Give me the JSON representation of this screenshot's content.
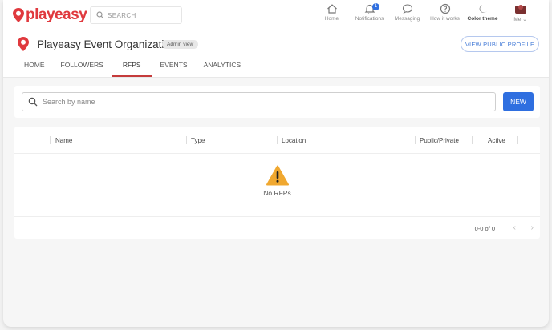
{
  "brand": {
    "logo_text": "playeasy"
  },
  "search": {
    "placeholder": "SEARCH"
  },
  "nav": {
    "items": [
      {
        "label": "Home",
        "icon": "home-icon"
      },
      {
        "label": "Notifications",
        "icon": "bell-icon",
        "badge": "1"
      },
      {
        "label": "Messaging",
        "icon": "chat-icon"
      },
      {
        "label": "How it works",
        "icon": "help-icon"
      },
      {
        "label": "Color theme",
        "icon": "moon-icon"
      },
      {
        "label": "Me",
        "icon": "avatar-icon"
      }
    ]
  },
  "org": {
    "name": "Playeasy Event Organization",
    "admin_badge": "Admin view",
    "view_profile_label": "VIEW PUBLIC PROFILE"
  },
  "tabs": [
    {
      "label": "HOME"
    },
    {
      "label": "FOLLOWERS"
    },
    {
      "label": "RFPS",
      "active": true
    },
    {
      "label": "EVENTS"
    },
    {
      "label": "ANALYTICS"
    }
  ],
  "rfp_search": {
    "placeholder": "Search by name",
    "new_label": "NEW"
  },
  "table": {
    "columns": [
      "Name",
      "Type",
      "Location",
      "Public/Private",
      "Active"
    ],
    "empty_message": "No RFPs",
    "pagination": "0-0 of 0"
  },
  "colors": {
    "brand_red": "#e0393e",
    "accent_blue": "#2f6fe0",
    "tab_underline": "#c53b3b"
  }
}
